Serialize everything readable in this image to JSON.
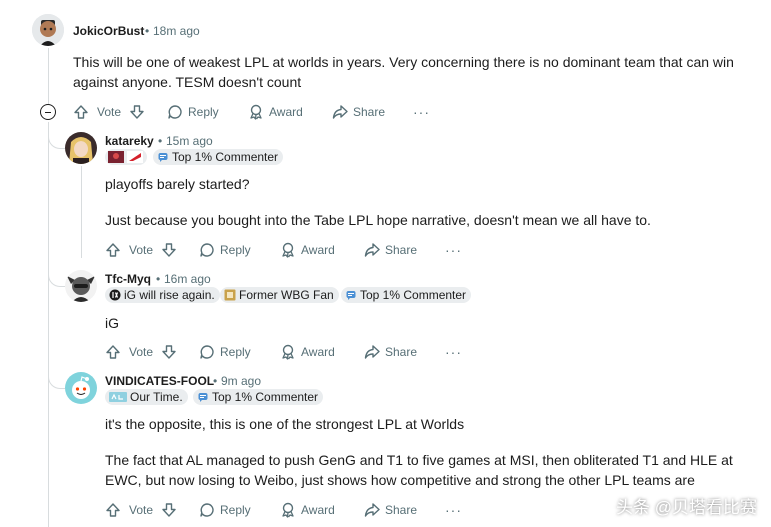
{
  "comments": [
    {
      "username": "JokicOrBust",
      "time": "18m ago",
      "body_lines": [
        "This will be one of weakest LPL at worlds in years. Very concerning there is no dominant team that can win",
        "against anyone. TESM doesn't count"
      ],
      "actions": {
        "vote": "Vote",
        "reply": "Reply",
        "award": "Award",
        "share": "Share"
      }
    },
    {
      "username": "katareky",
      "time": "15m ago",
      "badges": [
        "Top 1% Commenter"
      ],
      "body_lines": [
        "playoffs barely started?",
        "Just because you bought into the Tabe LPL hope narrative, doesn't mean we all have to."
      ],
      "actions": {
        "vote": "Vote",
        "reply": "Reply",
        "award": "Award",
        "share": "Share"
      }
    },
    {
      "username": "Tfc-Myq",
      "time": "16m ago",
      "badges": [
        "iG will rise again.",
        "Former WBG Fan",
        "Top 1% Commenter"
      ],
      "body_lines": [
        "iG"
      ],
      "actions": {
        "vote": "Vote",
        "reply": "Reply",
        "award": "Award",
        "share": "Share"
      }
    },
    {
      "username": "VINDICATES-FOOL",
      "time": "9m ago",
      "badges": [
        "Our Time.",
        "Top 1% Commenter"
      ],
      "body_lines": [
        "it's the opposite, this is one of the strongest LPL at Worlds",
        "The fact that AL managed to push GenG and T1 to five games at MSI, then obliterated T1 and HLE at",
        "EWC, but now losing to Weibo, just shows how competitive and strong the other LPL teams are"
      ],
      "actions": {
        "vote": "Vote",
        "reply": "Reply",
        "award": "Award",
        "share": "Share"
      }
    }
  ],
  "separator": "•",
  "more": "···",
  "watermark": "头条 @贝塔看比赛",
  "colors": {
    "text": "#1c1c1c",
    "muted": "#576f76",
    "badge_bg": "#eaedef",
    "thread": "#d8dcde"
  }
}
